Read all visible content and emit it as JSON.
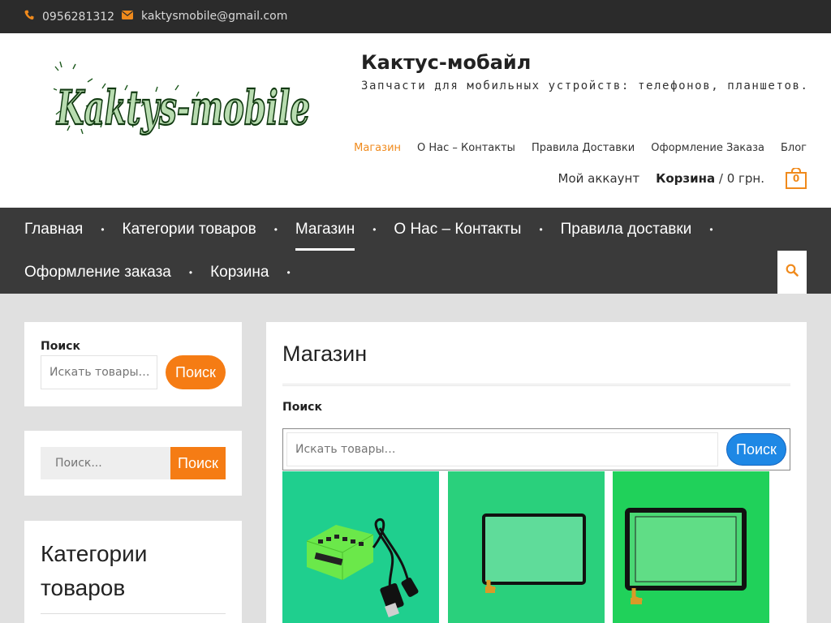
{
  "topbar": {
    "phone_icon": "phone-icon",
    "phone": "0956281312",
    "email_icon": "envelope-icon",
    "email": "kaktysmobile@gmail.com"
  },
  "header": {
    "logo_text": "Kaktys-mobile",
    "site_title": "Кактус-мобайл",
    "tagline": "Запчасти для мобильных устройств: телефонов, планшетов.",
    "top_menu": [
      {
        "label": "Магазин",
        "active": true
      },
      {
        "label": "О Нас – Контакты",
        "active": false
      },
      {
        "label": "Правила Доставки",
        "active": false
      },
      {
        "label": "Оформление Заказа",
        "active": false
      },
      {
        "label": "Блог",
        "active": false
      }
    ],
    "account_label": "Мой аккаунт",
    "cart_label": "Корзина",
    "cart_total": " / 0 грн.",
    "cart_count": "0",
    "cart_icon": "shopping-bag-icon"
  },
  "main_nav": {
    "row1": [
      {
        "label": "Главная",
        "active": false
      },
      {
        "label": "Категории товаров",
        "active": false
      },
      {
        "label": "Магазин",
        "active": true
      },
      {
        "label": "О Нас – Контакты",
        "active": false
      },
      {
        "label": "Правила доставки",
        "active": false
      }
    ],
    "row2": [
      {
        "label": "Оформление заказа",
        "active": false
      },
      {
        "label": "Корзина",
        "active": false
      }
    ],
    "search_icon": "search-icon"
  },
  "sidebar": {
    "search_widget": {
      "label": "Поиск",
      "placeholder": "Искать товары…",
      "button": "Поиск"
    },
    "search_widget2": {
      "placeholder": "Поиск...",
      "button": "Поиск"
    },
    "categories_title": "Категории товаров"
  },
  "content": {
    "page_title": "Магазин",
    "search_label": "Поиск",
    "search_placeholder": "Искать товары…",
    "search_button": "Поиск"
  },
  "colors": {
    "accent": "#f57c14",
    "topbar_bg": "#2b2b2b",
    "nav_bg": "#3a3a3a",
    "search_button_blue": "#1e88e5"
  }
}
